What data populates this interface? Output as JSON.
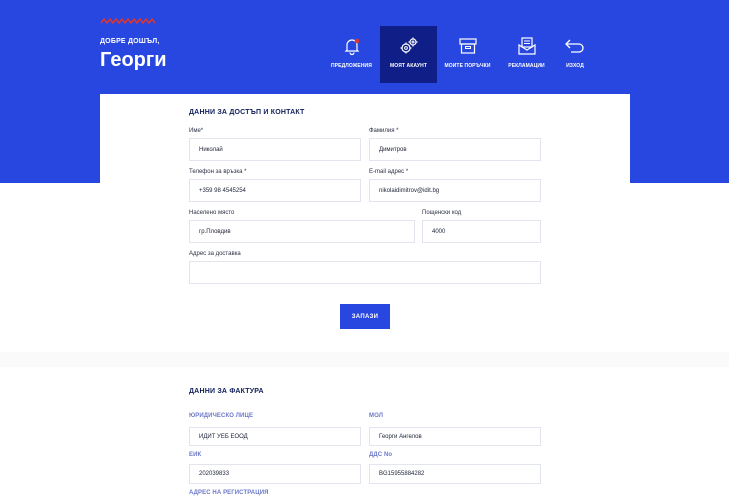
{
  "header": {
    "welcome": "ДОБРЕ ДОШЪЛ,",
    "username": "Георги",
    "nav": [
      {
        "label": "ПРЕДЛОЖЕНИЯ",
        "icon": "bell-icon"
      },
      {
        "label": "МОЯТ АКАУНТ",
        "icon": "gears-icon",
        "active": true
      },
      {
        "label": "МОИТЕ ПОРЪЧКИ",
        "icon": "box-icon"
      },
      {
        "label": "РЕКЛАМАЦИИ",
        "icon": "document-envelope-icon"
      },
      {
        "label": "ИЗХОД",
        "icon": "return-arrow-icon"
      }
    ]
  },
  "contact": {
    "title": "ДАННИ ЗА ДОСТЪП И КОНТАКТ",
    "first_name_label": "Име*",
    "first_name": "Николай",
    "last_name_label": "Фамилия *",
    "last_name": "Димитров",
    "phone_label": "Телефон за връзка *",
    "phone": "+359 98 4545254",
    "email_label": "E-mail адрес *",
    "email": "nikolaidimitrov@idit.bg",
    "city_label": "Населено място",
    "city": "гр.Пловдив",
    "postcode_label": "Пощенски код",
    "postcode": "4000",
    "address_label": "Адрес за доставка",
    "address": "",
    "save": "ЗАПАЗИ"
  },
  "invoice": {
    "title": "ДАННИ ЗА ФАКТУРА",
    "company_label": "ЮРИДИЧЕСКО ЛИЦЕ",
    "company": "ИДИТ УЕБ ЕООД",
    "mol_label": "МОЛ",
    "mol": "Георги Ангелов",
    "eik_label": "ЕИК",
    "eik": "202039833",
    "dds_label": "ДДС No",
    "dds": "BG15955884282",
    "reg_address_label": "АДРЕС НА РЕГИСТРАЦИЯ"
  },
  "colors": {
    "brand": "#2747e0",
    "nav_active": "#0f1f87",
    "logo": "#e0352b"
  }
}
